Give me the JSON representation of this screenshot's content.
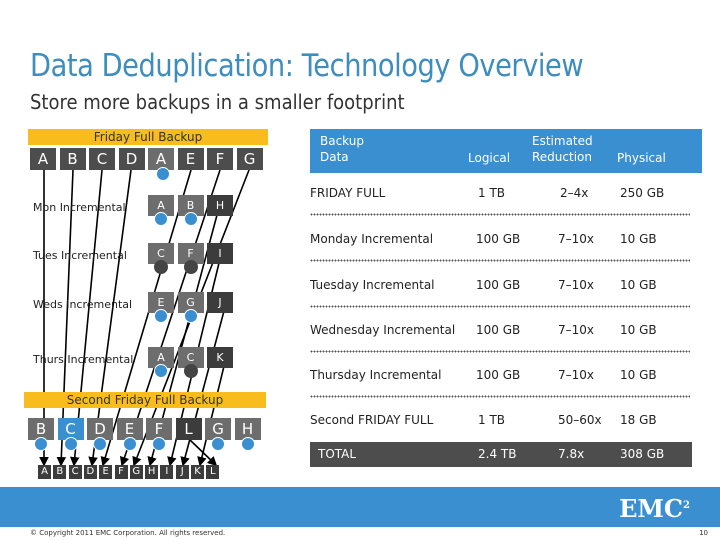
{
  "title": "Data Deduplication: Technology Overview",
  "subtitle": "Store more backups in a smaller footprint",
  "diagram": {
    "friday_label": "Friday Full Backup",
    "friday_blocks": [
      "A",
      "B",
      "C",
      "D",
      "A",
      "E",
      "F",
      "G"
    ],
    "rows": [
      {
        "label": "Mon Incremental",
        "blocks": [
          "A",
          "B",
          "H"
        ]
      },
      {
        "label": "Tues Incremental",
        "blocks": [
          "C",
          "F",
          "I"
        ]
      },
      {
        "label": "Weds Incremental",
        "blocks": [
          "E",
          "G",
          "J"
        ]
      },
      {
        "label": "Thurs Incremental",
        "blocks": [
          "A",
          "C",
          "K"
        ]
      }
    ],
    "second_label": "Second Friday Full Backup",
    "second_blocks": [
      "B",
      "C",
      "D",
      "E",
      "F",
      "L",
      "G",
      "H"
    ],
    "unique_blocks": [
      "A",
      "B",
      "C",
      "D",
      "E",
      "F",
      "G",
      "H",
      "I",
      "J",
      "K",
      "L"
    ]
  },
  "table": {
    "headers": {
      "data": "Backup Data",
      "logical": "Logical",
      "reduction": "Estimated Reduction",
      "physical": "Physical"
    },
    "rows": [
      {
        "data": "FRIDAY FULL",
        "logical": "1 TB",
        "reduction": "2–4x",
        "physical": "250 GB"
      },
      {
        "data": "Monday Incremental",
        "logical": "100 GB",
        "reduction": "7–10x",
        "physical": "10 GB"
      },
      {
        "data": "Tuesday Incremental",
        "logical": "100 GB",
        "reduction": "7–10x",
        "physical": "10 GB"
      },
      {
        "data": "Wednesday Incremental",
        "logical": "100 GB",
        "reduction": "7–10x",
        "physical": "10 GB"
      },
      {
        "data": "Thursday Incremental",
        "logical": "100 GB",
        "reduction": "7–10x",
        "physical": "10 GB"
      },
      {
        "data": "Second FRIDAY FULL",
        "logical": "1 TB",
        "reduction": "50–60x",
        "physical": "18 GB"
      }
    ],
    "total": {
      "data": "TOTAL",
      "logical": "2.4 TB",
      "reduction": "7.8x",
      "physical": "308 GB"
    }
  },
  "footer": {
    "logo": "EMC",
    "logo_sup": "2",
    "copyright": "© Copyright 2011 EMC Corporation. All rights reserved.",
    "page": "10"
  },
  "colors": {
    "accent": "#3a8fd0",
    "highlight": "#f8bd1c",
    "block": "#4d4d4d",
    "title": "#3d8dbe"
  }
}
